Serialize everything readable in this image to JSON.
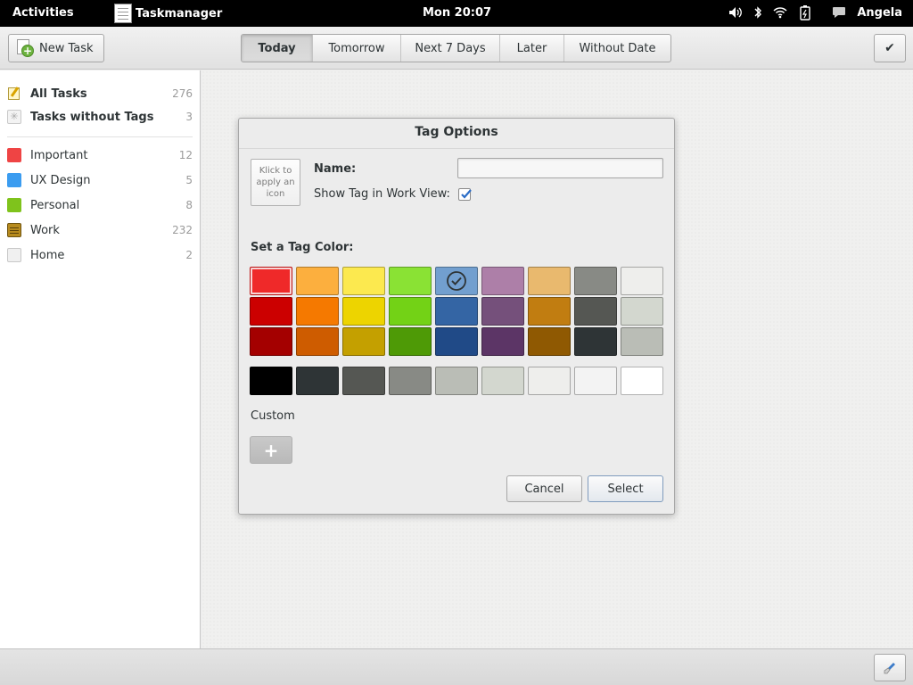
{
  "topbar": {
    "activities": "Activities",
    "app_name": "Taskmanager",
    "clock": "Mon 20:07",
    "user": "Angela"
  },
  "toolbar": {
    "new_task": "New Task",
    "tabs": [
      {
        "label": "Today",
        "active": true
      },
      {
        "label": "Tomorrow",
        "active": false
      },
      {
        "label": "Next 7 Days",
        "active": false
      },
      {
        "label": "Later",
        "active": false
      },
      {
        "label": "Without Date",
        "active": false
      }
    ],
    "confirm_glyph": "✔"
  },
  "sidebar": {
    "smart": [
      {
        "label": "All Tasks",
        "count": "276",
        "icon": "notepad-icon"
      },
      {
        "label": "Tasks without Tags",
        "count": "3",
        "icon": "no-tag-icon"
      }
    ],
    "tags": [
      {
        "label": "Important",
        "count": "12",
        "color": "#ef4444"
      },
      {
        "label": "UX Design",
        "count": "5",
        "color": "#3b9cf0"
      },
      {
        "label": "Personal",
        "count": "8",
        "color": "#7fc31c"
      },
      {
        "label": "Work",
        "count": "232",
        "color": "#b78b1e"
      },
      {
        "label": "Home",
        "count": "2",
        "color": "#f0f0f0"
      }
    ]
  },
  "dialog": {
    "title": "Tag Options",
    "icon_placeholder": "Klick to apply an icon",
    "name_label": "Name:",
    "name_value": "",
    "show_label": "Show Tag in Work View:",
    "show_checked": true,
    "color_label": "Set a Tag Color:",
    "palette_rows": [
      [
        "#ef2929",
        "#fcaf3e",
        "#fce94f",
        "#8ae234",
        "#729fcf",
        "#ad7fa8",
        "#e9b96e",
        "#888a85",
        "#eeeeec"
      ],
      [
        "#cc0000",
        "#f57900",
        "#edd400",
        "#73d216",
        "#3465a4",
        "#75507b",
        "#c17d11",
        "#555753",
        "#d3d7cf"
      ],
      [
        "#a40000",
        "#ce5c00",
        "#c4a000",
        "#4e9a06",
        "#204a87",
        "#5c3566",
        "#8f5902",
        "#2e3436",
        "#babdb6"
      ]
    ],
    "grayscale_row": [
      "#000000",
      "#2e3436",
      "#555753",
      "#888a85",
      "#babdb6",
      "#d3d7cf",
      "#eeeeec",
      "#f3f3f3",
      "#ffffff"
    ],
    "selected_cell": "red",
    "checked_cell": "blue",
    "custom_label": "Custom",
    "add_custom": "+",
    "cancel": "Cancel",
    "select": "Select"
  }
}
